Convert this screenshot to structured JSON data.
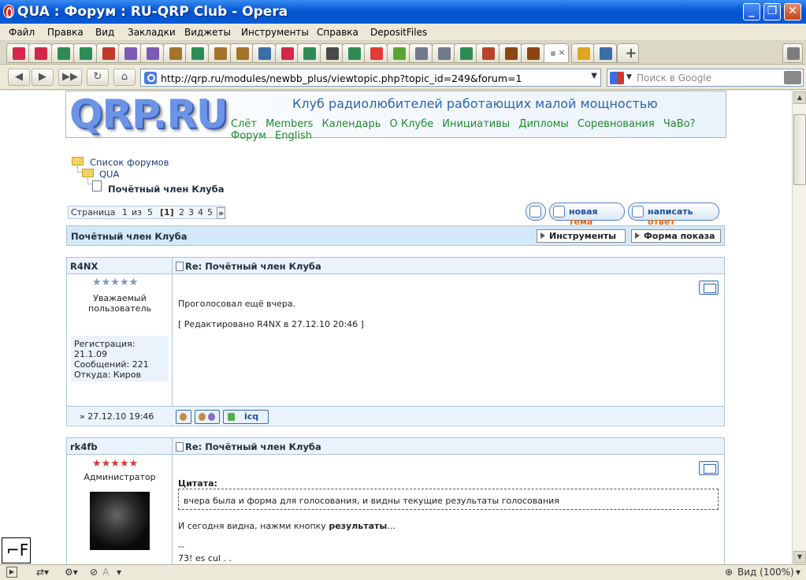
{
  "window": {
    "title": "QUA : Форум : RU-QRP Club - Opera",
    "controls": [
      "_",
      "❐",
      "✕"
    ]
  },
  "menu": [
    "Файл",
    "Правка",
    "Вид",
    "Закладки",
    "Виджеты",
    "Инструменты",
    "Справка",
    "DepositFiles"
  ],
  "tabs": [
    {
      "icon": "cq-ham-icon",
      "color": "#d6264a"
    },
    {
      "icon": "cq-ham-icon",
      "color": "#d6264a"
    },
    {
      "icon": "page-icon",
      "color": "#2e8b57"
    },
    {
      "icon": "page-icon",
      "color": "#2e8b57"
    },
    {
      "icon": "t-icon",
      "color": "#c0392b"
    },
    {
      "icon": "people-icon",
      "color": "#7b5bb5"
    },
    {
      "icon": "people-icon",
      "color": "#7b5bb5"
    },
    {
      "icon": "people-icon",
      "color": "#a4742a"
    },
    {
      "icon": "page-icon",
      "color": "#2e8b57"
    },
    {
      "icon": "people-icon",
      "color": "#a4742a"
    },
    {
      "icon": "people-icon",
      "color": "#a4742a"
    },
    {
      "icon": "blue-icon",
      "color": "#3a6ea8"
    },
    {
      "icon": "cq-ham-icon",
      "color": "#d6264a"
    },
    {
      "icon": "page-icon",
      "color": "#2e8b57"
    },
    {
      "icon": "pen-icon",
      "color": "#4a4a4a"
    },
    {
      "icon": "page-icon",
      "color": "#2e8b57"
    },
    {
      "icon": "yandex-icon",
      "color": "#e53935"
    },
    {
      "icon": "help-icon",
      "color": "#55a630"
    },
    {
      "icon": "doc-icon",
      "color": "#6f7b8b"
    },
    {
      "icon": "doc-icon",
      "color": "#6f7b8b"
    },
    {
      "icon": "page-icon",
      "color": "#2e8b57"
    },
    {
      "icon": "book-icon",
      "color": "#b8442c"
    },
    {
      "icon": "footprint-icon",
      "color": "#8b4513"
    },
    {
      "icon": "footprint-icon",
      "color": "#8b4513"
    },
    {
      "icon": "active-tab-icon",
      "color": "#9aa3ad"
    },
    {
      "icon": "people-icon",
      "color": "#e0a420"
    },
    {
      "icon": "search-blue-icon",
      "color": "#3a6ea8"
    }
  ],
  "active_tab_close": "×",
  "address": {
    "url": "http://qrp.ru/modules/newbb_plus/viewtopic.php?topic_id=249&forum=1",
    "search_placeholder": "Поиск в Google"
  },
  "site": {
    "logo": "QRP.RU",
    "slogan": "Клуб радиолюбителей работающих малой мощностью",
    "nav": [
      "Слёт",
      "Members",
      "Календарь",
      "О Клубе",
      "Инициативы",
      "Дипломы",
      "Соревнования",
      "ЧаВо?",
      "Форум",
      "English"
    ]
  },
  "breadcrumb": {
    "forums": "Список форумов",
    "forum": "QUA",
    "topic": "Почётный член Клуба"
  },
  "pager": {
    "label": "Страница",
    "current": "1",
    "of": "из",
    "total": "5",
    "current_link": "[1]",
    "pages": [
      "2",
      "3",
      "4",
      "5"
    ],
    "next": "»"
  },
  "buttons": {
    "new_topic_a": "новая ",
    "new_topic_b": "тема",
    "reply_a": "написать ",
    "reply_b": "ответ"
  },
  "topic_bar": {
    "title": "Почётный член Клуба",
    "tools": "Инструменты",
    "display": "Форма показа"
  },
  "posts": [
    {
      "user": "R4NX",
      "title": "Re: Почётный член Клуба",
      "stars": "★★★★★",
      "star_color": "#7f99b8",
      "rank": "Уважаемый пользователь",
      "text1": "Проголосовал ещё вчера.",
      "text2": "[ Редактировано R4NX в 27.12.10 20:46 ]",
      "info": [
        "Регистрация:",
        "21.1.09",
        "Сообщений: 221",
        "Откуда: Киров"
      ],
      "date": "» 27.12.10 19:46",
      "icq": "icq"
    },
    {
      "user": "rk4fb",
      "title": "Re: Почётный член Клуба",
      "stars": "★★★★★",
      "star_color": "#d23a3a",
      "rank": "Администратор",
      "quote_label": "Цитата:",
      "quote_text": "вчера была и форма для голосования, и видны текущие результаты голосования",
      "text1": "И сегодня видна, нажми кнопку ",
      "text1_bold": "результаты",
      "text1_end": "...",
      "sig1": "--",
      "sig2": "73! es cul . ."
    }
  ],
  "status": {
    "zoom": "Вид (100%)",
    "indicator": "A"
  }
}
